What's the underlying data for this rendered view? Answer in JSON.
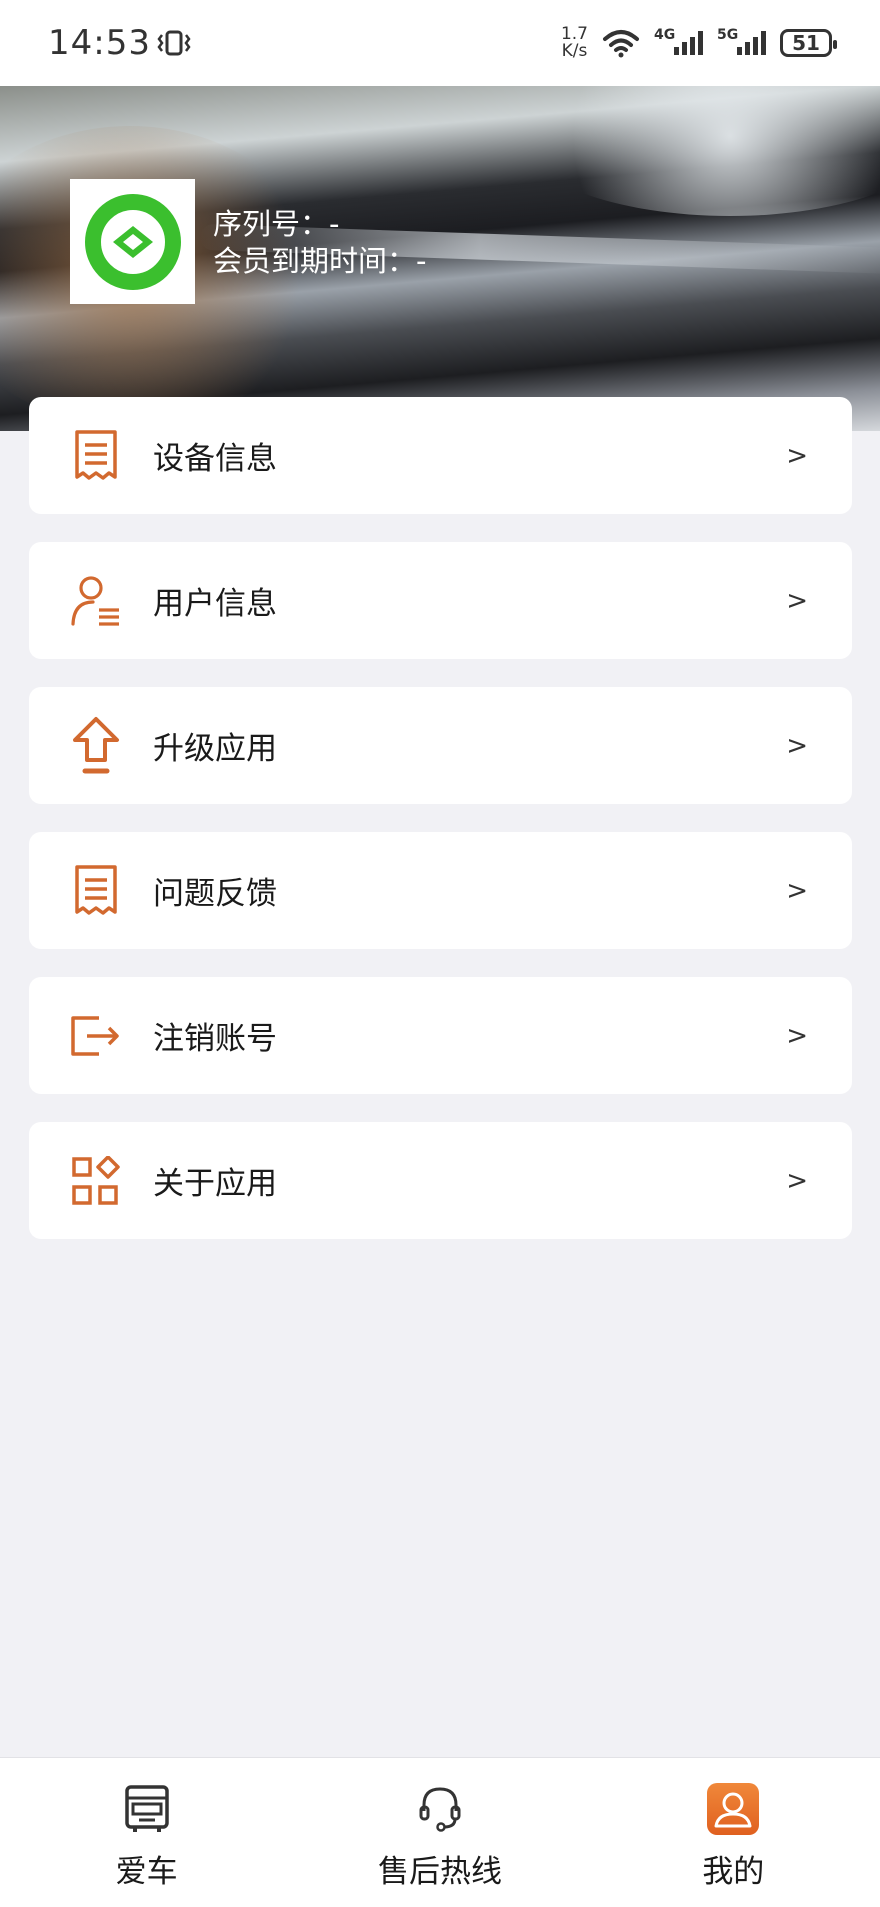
{
  "status_bar": {
    "time": "14:53",
    "net_speed_value": "1.7",
    "net_speed_unit": "K/s",
    "network_4g": "4G",
    "network_5g": "5G",
    "battery": "51"
  },
  "profile": {
    "serial_label": "序列号：-",
    "expiry_label": "会员到期时间：-"
  },
  "menu": {
    "items": [
      {
        "label": "设备信息",
        "icon": "receipt-icon",
        "arrow": ">"
      },
      {
        "label": "用户信息",
        "icon": "user-list-icon",
        "arrow": ">"
      },
      {
        "label": "升级应用",
        "icon": "upgrade-arrow-icon",
        "arrow": ">"
      },
      {
        "label": "问题反馈",
        "icon": "receipt-icon",
        "arrow": ">"
      },
      {
        "label": "注销账号",
        "icon": "logout-icon",
        "arrow": ">"
      },
      {
        "label": "关于应用",
        "icon": "apps-grid-icon",
        "arrow": ">"
      }
    ]
  },
  "tabs": [
    {
      "label": "爱车",
      "icon": "truck-icon",
      "active": false
    },
    {
      "label": "售后热线",
      "icon": "headset-icon",
      "active": false
    },
    {
      "label": "我的",
      "icon": "profile-icon",
      "active": true
    }
  ],
  "colors": {
    "accent": "#d2692f",
    "logo_green": "#3bbf2e",
    "background": "#f1f1f5"
  }
}
